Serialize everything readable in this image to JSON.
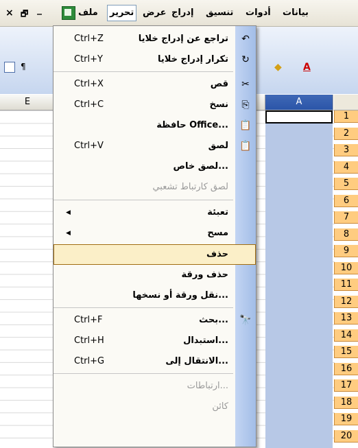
{
  "menubar": {
    "items": [
      "بيانات",
      "أدوات",
      "تنسيق",
      "إدراج",
      "عرض",
      "تحرير",
      "ملف"
    ],
    "window_controls": [
      "×",
      "🗗",
      "_"
    ]
  },
  "toolbar": {
    "left_icons": [
      "paste-special-icon",
      "rtl-icon"
    ],
    "right_icons": [
      "fill-color-icon",
      "font-color-icon"
    ]
  },
  "sheet": {
    "columns": [
      "E",
      "A"
    ],
    "rows": [
      "1",
      "2",
      "3",
      "4",
      "5",
      "6",
      "7",
      "8",
      "9",
      "10",
      "11",
      "12",
      "13",
      "14",
      "15",
      "16",
      "17",
      "18",
      "19",
      "20"
    ]
  },
  "menu": {
    "title": "تحرير",
    "items": [
      {
        "label": "تراجع عن إدراج خلايا",
        "shortcut": "Ctrl+Z",
        "icon": "undo-icon",
        "glyph": "↶"
      },
      {
        "label": "تكرار إدراج خلايا",
        "shortcut": "Ctrl+Y",
        "icon": "redo-icon",
        "glyph": "↻"
      },
      {
        "label": "قص",
        "shortcut": "Ctrl+X",
        "icon": "cut-icon",
        "glyph": "✂"
      },
      {
        "label": "نسخ",
        "shortcut": "Ctrl+C",
        "icon": "copy-icon",
        "glyph": "⎘"
      },
      {
        "label": "حافظة Office...",
        "shortcut": "",
        "icon": "clipboard-icon",
        "glyph": "📋"
      },
      {
        "label": "لصق",
        "shortcut": "Ctrl+V",
        "icon": "paste-icon",
        "glyph": "📋"
      },
      {
        "label": "لصق خاص...",
        "shortcut": "",
        "icon": "",
        "glyph": ""
      },
      {
        "label": "لصق كارتباط تشعبي",
        "shortcut": "",
        "icon": "",
        "glyph": "",
        "disabled": true
      },
      {
        "label": "تعبئة",
        "shortcut": "",
        "icon": "",
        "glyph": "",
        "submenu": true
      },
      {
        "label": "مسح",
        "shortcut": "",
        "icon": "",
        "glyph": "",
        "submenu": true
      },
      {
        "label": "حذف",
        "shortcut": "",
        "icon": "",
        "glyph": "",
        "highlighted": true
      },
      {
        "label": "حذف ورقة",
        "shortcut": "",
        "icon": "",
        "glyph": ""
      },
      {
        "label": "نقل ورقة أو نسخها...",
        "shortcut": "",
        "icon": "",
        "glyph": ""
      },
      {
        "label": "بحث...",
        "shortcut": "Ctrl+F",
        "icon": "find-icon",
        "glyph": "🔭"
      },
      {
        "label": "استبدال...",
        "shortcut": "Ctrl+H",
        "icon": "",
        "glyph": ""
      },
      {
        "label": "الانتقال إلى...",
        "shortcut": "Ctrl+G",
        "icon": "",
        "glyph": ""
      },
      {
        "label": "ارتباطات...",
        "shortcut": "",
        "icon": "",
        "glyph": "",
        "disabled": true
      },
      {
        "label": "كائن",
        "shortcut": "",
        "icon": "",
        "glyph": "",
        "disabled": true
      }
    ]
  }
}
